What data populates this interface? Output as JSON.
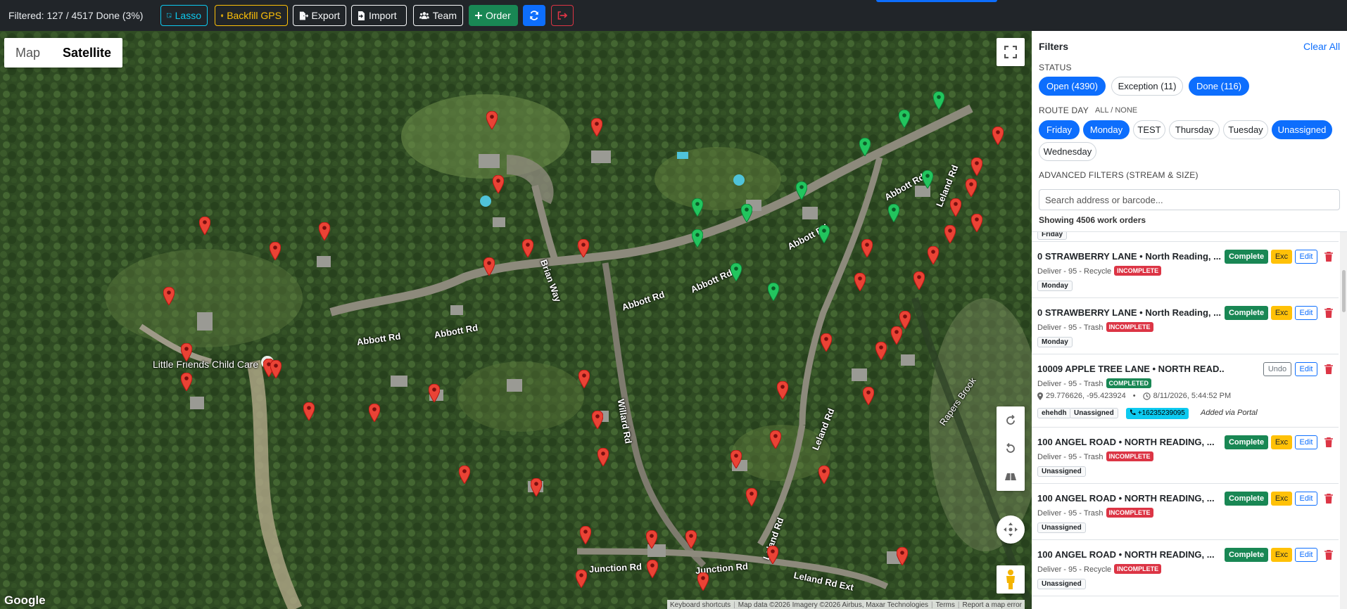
{
  "toolbar": {
    "filter_status": "Filtered: 127 / 4517 Done (3%)",
    "lasso": "Lasso",
    "backfill": "Backfill GPS",
    "export": "Export",
    "import": "Import",
    "team": "Team",
    "order": "Order"
  },
  "map": {
    "type_map": "Map",
    "type_satellite": "Satellite",
    "labels": {
      "abbott1": "Abbott Rd",
      "abbott2": "Abbott Rd",
      "abbott3": "Abbott Rd",
      "abbott4": "Abbott Rd",
      "abbott5": "Abbott Rd",
      "abbott6": "Abbott Rd",
      "brian": "Brian Way",
      "willard": "Willard Rd",
      "leland1": "Leland Rd",
      "leland2": "Leland Rd",
      "leland3": "Leland Rd",
      "leland_ext": "Leland Rd Ext",
      "junction1": "Junction Rd",
      "junction2": "Junction Rd",
      "rapers": "Rapers Brook",
      "poi": "Little Friends Child Care"
    },
    "google": "Google",
    "attribution": {
      "shortcuts": "Keyboard shortcuts",
      "mapdata": "Map data ©2026 Imagery ©2026 Airbus, Maxar Technologies",
      "terms": "Terms",
      "report": "Report a map error"
    },
    "colors": {
      "incomplete_pin": "#ea4335",
      "done_pin": "#22c55e"
    }
  },
  "filters": {
    "title": "Filters",
    "clear_all": "Clear All",
    "status_label": "STATUS",
    "status": [
      {
        "label": "Open (4390)",
        "active": true
      },
      {
        "label": "Exception (11)",
        "active": false
      },
      {
        "label": "Done (116)",
        "active": true
      }
    ],
    "route_day_label": "ROUTE DAY",
    "all_none": "ALL / NONE",
    "route_days": [
      {
        "label": "Friday",
        "active": true
      },
      {
        "label": "Monday",
        "active": true
      },
      {
        "label": "TEST",
        "active": false
      },
      {
        "label": "Thursday",
        "active": false
      },
      {
        "label": "Tuesday",
        "active": false
      },
      {
        "label": "Unassigned",
        "active": true
      },
      {
        "label": "Wednesday",
        "active": false
      }
    ],
    "advanced_label": "ADVANCED FILTERS (STREAM & SIZE)",
    "search_placeholder": "Search address or barcode...",
    "showing": "Showing 4506 work orders"
  },
  "orders": {
    "partial_tag": "Friday",
    "complete_label": "Complete",
    "exc_label": "Exc",
    "edit_label": "Edit",
    "undo_label": "Undo",
    "items": [
      {
        "title": "0 STRAWBERRY LANE • North Reading, ...",
        "sub": "Deliver - 95 - Recycle",
        "badge": "INCOMPLETE",
        "tag": "Monday"
      },
      {
        "title": "0 STRAWBERRY LANE • North Reading, ...",
        "sub": "Deliver - 95 - Trash",
        "badge": "INCOMPLETE",
        "tag": "Monday"
      },
      {
        "title": "10009 APPLE TREE LANE • NORTH READ...",
        "sub": "Deliver - 95 - Trash",
        "badge": "COMPLETED",
        "coords": "29.776626, -95.423924",
        "time": "8/11/2026, 5:44:52 PM",
        "tags": [
          "ehehdh",
          "Unassigned"
        ],
        "phone": "+16235239095",
        "portal": "Added via Portal"
      },
      {
        "title": "100 ANGEL ROAD • NORTH READING, ...",
        "sub": "Deliver - 95 - Trash",
        "badge": "INCOMPLETE",
        "tag": "Unassigned"
      },
      {
        "title": "100 ANGEL ROAD • NORTH READING, ...",
        "sub": "Deliver - 95 - Trash",
        "badge": "INCOMPLETE",
        "tag": "Unassigned"
      },
      {
        "title": "100 ANGEL ROAD • NORTH READING, ...",
        "sub": "Deliver - 95 - Recycle",
        "badge": "INCOMPLETE",
        "tag": "Unassigned"
      }
    ]
  }
}
